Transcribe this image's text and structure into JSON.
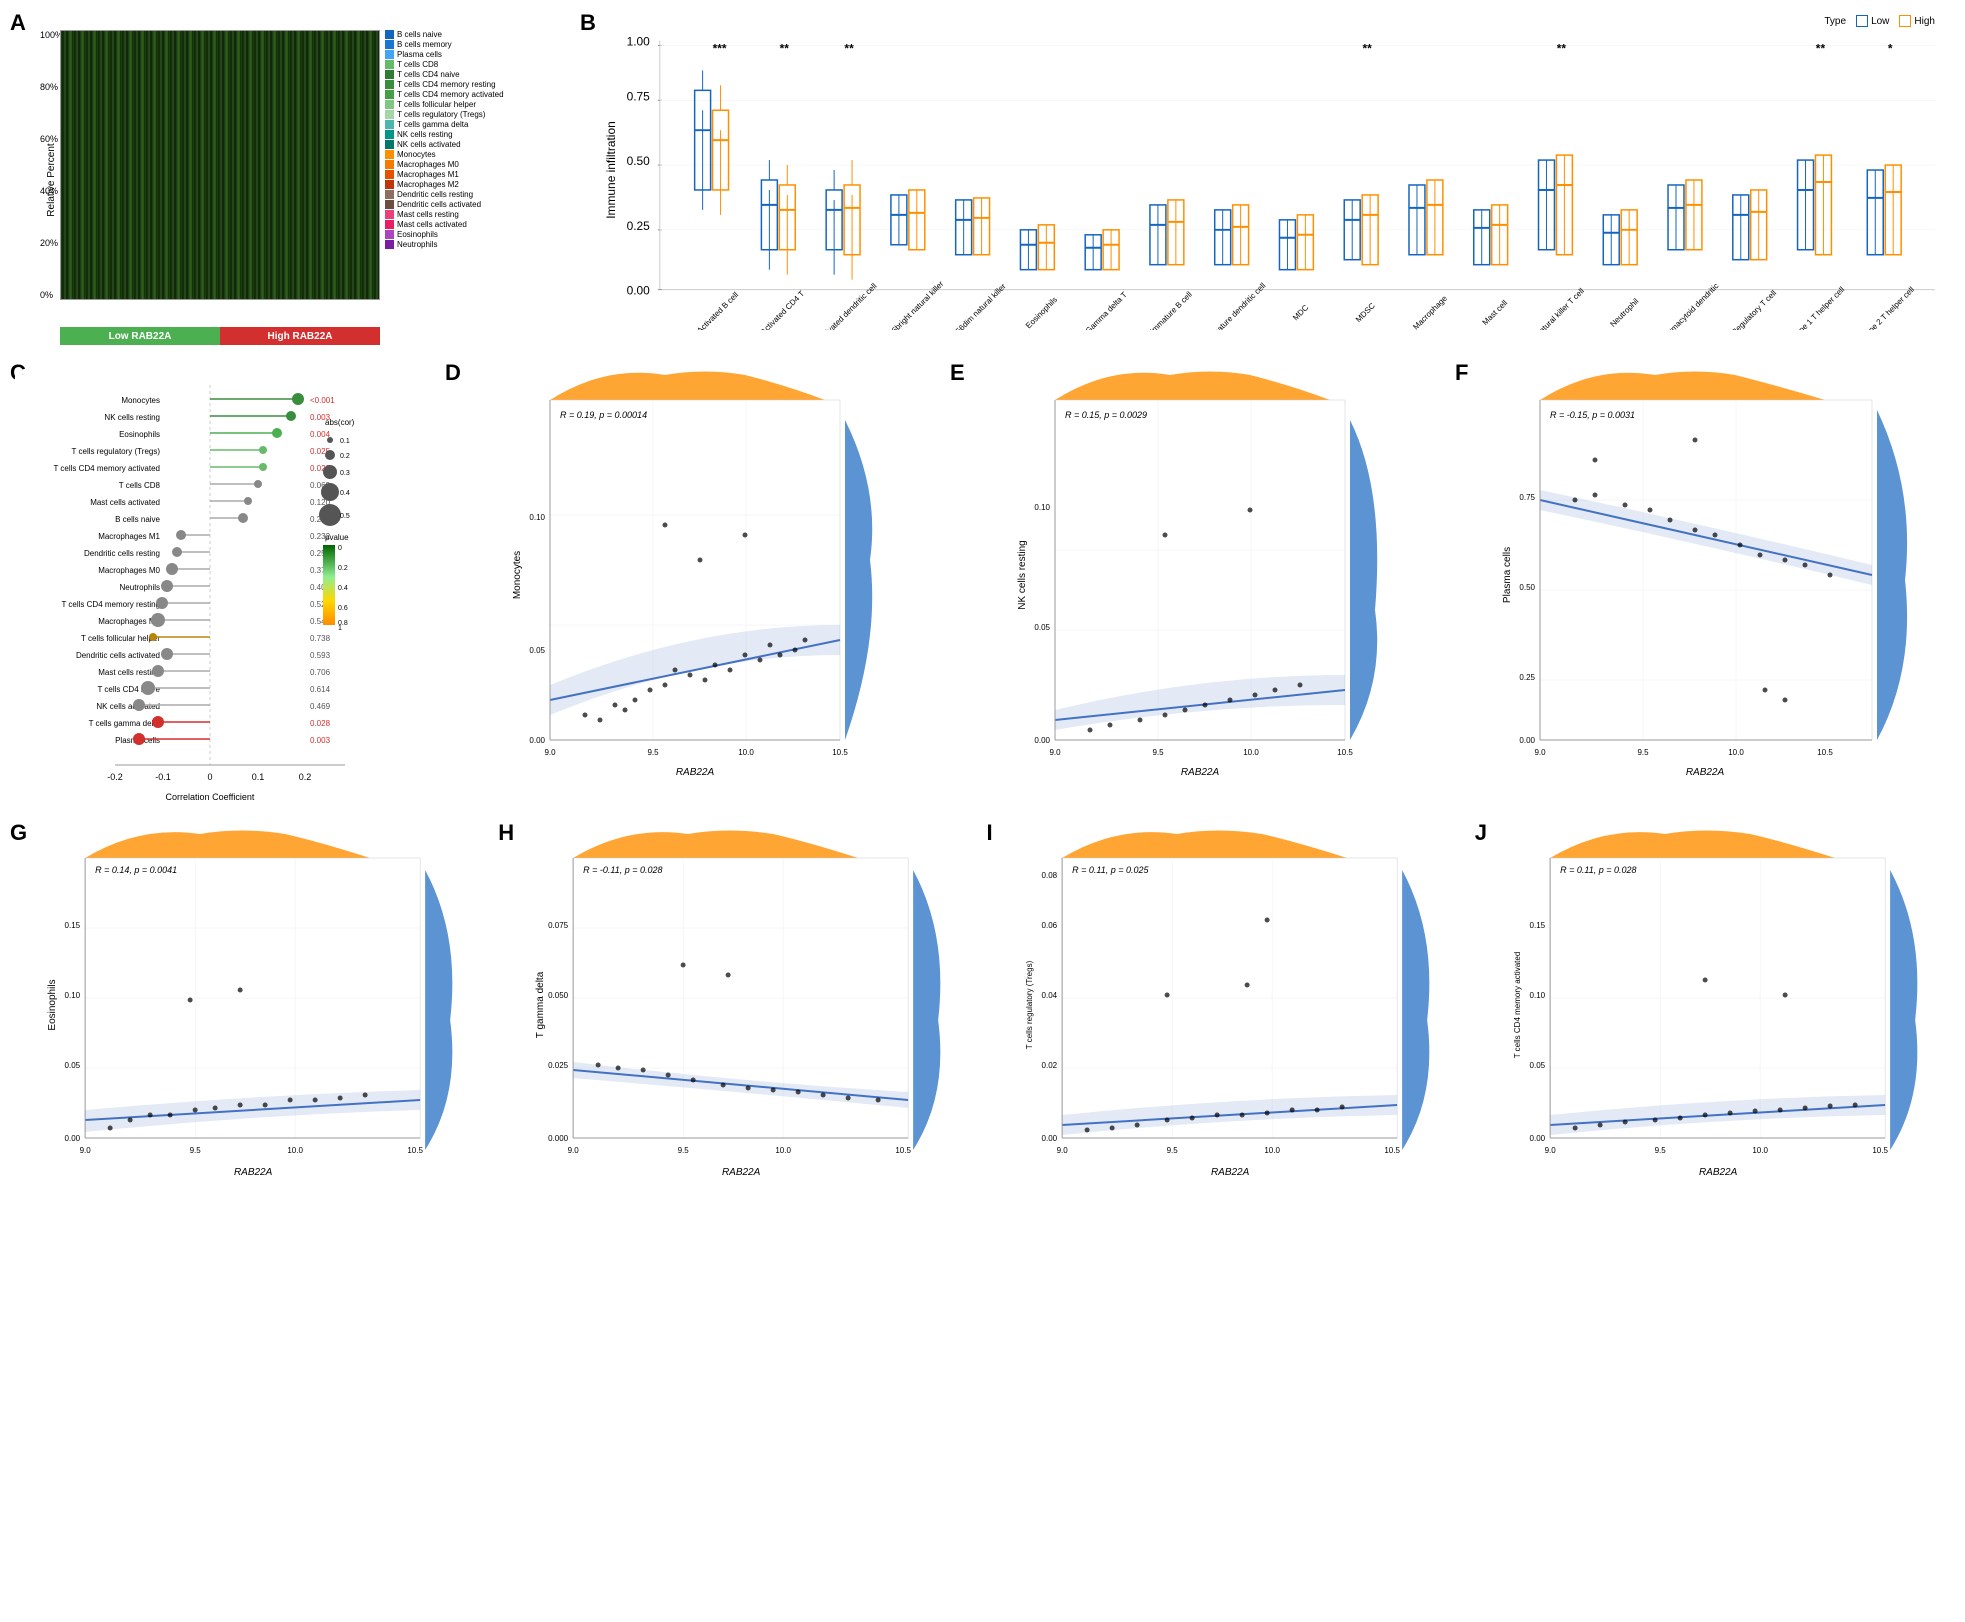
{
  "panels": {
    "a": {
      "label": "A",
      "y_axis": "Relative Percent",
      "y_ticks": [
        "100%",
        "80%",
        "60%",
        "40%",
        "20%",
        "0%"
      ],
      "x_low": "Low RAB22A",
      "x_high": "High RAB22A",
      "legend": [
        {
          "color": "#1565c0",
          "text": "B cells naive"
        },
        {
          "color": "#1976d2",
          "text": "B cells memory"
        },
        {
          "color": "#42a5f5",
          "text": "Plasma cells"
        },
        {
          "color": "#66bb6a",
          "text": "T cells CD8"
        },
        {
          "color": "#2e7d32",
          "text": "T cells CD4 naive"
        },
        {
          "color": "#388e3c",
          "text": "T cells CD4 memory resting"
        },
        {
          "color": "#43a047",
          "text": "T cells CD4 memory activated"
        },
        {
          "color": "#81c784",
          "text": "T cells follicular helper"
        },
        {
          "color": "#a5d6a7",
          "text": "T cells regulatory (Tregs)"
        },
        {
          "color": "#4db6ac",
          "text": "T cells gamma delta"
        },
        {
          "color": "#009688",
          "text": "NK cells resting"
        },
        {
          "color": "#00796b",
          "text": "NK cells activated"
        },
        {
          "color": "#ff8f00",
          "text": "Monocytes"
        },
        {
          "color": "#f57c00",
          "text": "Macrophages M0"
        },
        {
          "color": "#e65100",
          "text": "Macrophages M1"
        },
        {
          "color": "#bf360c",
          "text": "Macrophages M2"
        },
        {
          "color": "#8d6e63",
          "text": "Dendritic cells resting"
        },
        {
          "color": "#6d4c41",
          "text": "Dendritic cells activated"
        },
        {
          "color": "#ec407a",
          "text": "Mast cells resting"
        },
        {
          "color": "#e91e63",
          "text": "Mast cells activated"
        },
        {
          "color": "#ab47bc",
          "text": "Eosinophils"
        },
        {
          "color": "#7b1fa2",
          "text": "Neutrophils"
        }
      ]
    },
    "b": {
      "label": "B",
      "type_legend": {
        "title": "Type",
        "low": {
          "color": "#1565c0",
          "label": "Low"
        },
        "high": {
          "color": "#ff8f00",
          "label": "High"
        }
      },
      "y_axis": "Immune infiltration",
      "significance": [
        "***",
        "**",
        "**",
        "",
        "",
        "",
        "",
        "**",
        "",
        "",
        "",
        "",
        "",
        "**",
        "",
        "",
        "*"
      ]
    },
    "c": {
      "label": "C",
      "x_axis": "Correlation Coefficient",
      "items": [
        {
          "label": "Monocytes",
          "corr": 0.19,
          "pval_text": "<0.001",
          "pval_color": "#d32f2f",
          "dot_size": 8,
          "dot_color": "#388e3c"
        },
        {
          "label": "NK cells resting",
          "corr": 0.17,
          "pval_text": "0.003",
          "pval_color": "#d32f2f",
          "dot_size": 7,
          "dot_color": "#388e3c"
        },
        {
          "label": "Eosinophils",
          "corr": 0.14,
          "pval_text": "0.004",
          "pval_color": "#d32f2f",
          "dot_size": 7,
          "dot_color": "#388e3c"
        },
        {
          "label": "T cells regulatory (Tregs)",
          "corr": 0.11,
          "pval_text": "0.025",
          "pval_color": "#d32f2f",
          "dot_size": 6,
          "dot_color": "#388e3c"
        },
        {
          "label": "T cells CD4 memory activated",
          "corr": 0.11,
          "pval_text": "0.028",
          "pval_color": "#d32f2f",
          "dot_size": 6,
          "dot_color": "#388e3c"
        },
        {
          "label": "T cells CD8",
          "corr": 0.1,
          "pval_text": "0.069",
          "dot_size": 5,
          "dot_color": "#555"
        },
        {
          "label": "Mast cells activated",
          "corr": 0.08,
          "pval_text": "0.120",
          "dot_size": 5,
          "dot_color": "#555"
        },
        {
          "label": "B cells naive",
          "corr": 0.07,
          "pval_text": "0.232",
          "dot_size": 6,
          "dot_color": "#555"
        },
        {
          "label": "Macrophages M1",
          "corr": -0.06,
          "pval_text": "0.232",
          "dot_size": 7,
          "dot_color": "#555"
        },
        {
          "label": "Dendritic cells resting",
          "corr": -0.07,
          "pval_text": "0.256",
          "dot_size": 7,
          "dot_color": "#555"
        },
        {
          "label": "Macrophages M0",
          "corr": -0.08,
          "pval_text": "0.374",
          "dot_size": 7,
          "dot_color": "#555"
        },
        {
          "label": "Neutrophils",
          "corr": -0.09,
          "pval_text": "0.409",
          "dot_size": 7,
          "dot_color": "#555"
        },
        {
          "label": "T cells CD4 memory resting",
          "corr": -0.1,
          "pval_text": "0.524",
          "dot_size": 8,
          "dot_color": "#555"
        },
        {
          "label": "Macrophages M2",
          "corr": -0.11,
          "pval_text": "0.549",
          "dot_size": 8,
          "dot_color": "#555"
        },
        {
          "label": "T cells follicular helper",
          "corr": -0.12,
          "pval_text": "0.738",
          "dot_size": 5,
          "dot_color": "#b8860b"
        },
        {
          "label": "Dendritic cells activated",
          "corr": -0.09,
          "pval_text": "0.593",
          "dot_size": 7,
          "dot_color": "#555"
        },
        {
          "label": "Mast cells resting",
          "corr": -0.11,
          "pval_text": "0.706",
          "dot_size": 7,
          "dot_color": "#555"
        },
        {
          "label": "T cells CD4 naive",
          "corr": -0.13,
          "pval_text": "0.614",
          "dot_size": 8,
          "dot_color": "#555"
        },
        {
          "label": "NK cells activated",
          "corr": -0.15,
          "pval_text": "0.469",
          "dot_size": 7,
          "dot_color": "#555"
        },
        {
          "label": "T cells gamma delta",
          "corr": -0.11,
          "pval_text": "0.028",
          "pval_color": "#d32f2f",
          "dot_size": 7,
          "dot_color": "#d32f2f"
        },
        {
          "label": "Plasma cells",
          "corr": -0.15,
          "pval_text": "0.003",
          "pval_color": "#d32f2f",
          "dot_size": 7,
          "dot_color": "#d32f2f"
        }
      ],
      "abs_corr_legend": [
        {
          "size": 4,
          "val": "0.1"
        },
        {
          "size": 7,
          "val": "0.2"
        },
        {
          "size": 10,
          "val": "0.3"
        },
        {
          "size": 14,
          "val": "0.4"
        },
        {
          "size": 18,
          "val": "0.5"
        }
      ],
      "pvalue_legend": [
        {
          "color": "#006400",
          "val": "0"
        },
        {
          "color": "#228b22",
          "val": "0.2"
        },
        {
          "color": "#90ee90",
          "val": "0.4"
        },
        {
          "color": "#ffd700",
          "val": "0.6"
        },
        {
          "color": "#ffa500",
          "val": "0.8"
        },
        {
          "color": "#ff8c00",
          "val": "1"
        }
      ]
    },
    "d": {
      "label": "D",
      "stat": "R = 0.19, p = 0.00014",
      "xlabel": "RAB22A",
      "ylabel": "Monocytes",
      "density_color_top": "#ff8f00",
      "density_color_right": "#1565c0"
    },
    "e": {
      "label": "E",
      "stat": "R = 0.15, p = 0.0029",
      "xlabel": "RAB22A",
      "ylabel": "NK cells resting",
      "density_color_top": "#ff8f00",
      "density_color_right": "#1565c0"
    },
    "f": {
      "label": "F",
      "stat": "R = -0.15, p = 0.0031",
      "xlabel": "RAB22A",
      "ylabel": "Plasma cells",
      "density_color_top": "#ff8f00",
      "density_color_right": "#1565c0"
    },
    "g": {
      "label": "G",
      "stat": "R = 0.14, p = 0.0041",
      "xlabel": "RAB22A",
      "ylabel": "Eosinophils",
      "density_color_top": "#ff8f00",
      "density_color_right": "#1565c0"
    },
    "h": {
      "label": "H",
      "stat": "R = -0.11, p = 0.028",
      "xlabel": "RAB22A",
      "ylabel": "T gamma delta",
      "density_color_top": "#ff8f00",
      "density_color_right": "#1565c0"
    },
    "i": {
      "label": "I",
      "stat": "R = 0.11, p = 0.025",
      "xlabel": "RAB22A",
      "ylabel": "T cells regulatory (Tregs)",
      "density_color_top": "#ff8f00",
      "density_color_right": "#1565c0"
    },
    "j": {
      "label": "J",
      "stat": "R = 0.11, p = 0.028",
      "xlabel": "RAB22A",
      "ylabel": "T cells CD4 memory activated",
      "density_color_top": "#ff8f00",
      "density_color_right": "#1565c0"
    }
  }
}
